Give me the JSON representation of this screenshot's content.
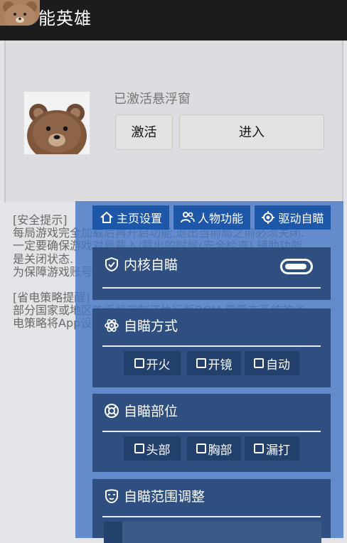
{
  "app": {
    "title": "能英雄"
  },
  "card": {
    "status": "已激活悬浮窗",
    "activate_label": "激活",
    "enter_label": "进入"
  },
  "notice": {
    "lines": [
      "[安全提示]",
      "每局游戏完全加载后再开启功能,退出当前局之前必须关闭.",
      "一定要确保游戏对局载入/载出的时候(安全检查),辅助功能",
      "是关闭状态.",
      "为保障游戏账号安全,推荐使用内核定制版",
      "",
      "[省电策略提醒]",
      "部分国家或地区的手机定制了执行版ROM,需要在系统的省",
      "电策略将App设置无限制."
    ]
  },
  "tabs": [
    {
      "label": "主页设置",
      "icon": "home-icon"
    },
    {
      "label": "人物功能",
      "icon": "people-icon"
    },
    {
      "label": "驱动自瞄",
      "icon": "target-icon"
    }
  ],
  "sections": {
    "kernel": {
      "title": "内核自瞄",
      "icon": "shield-check-icon",
      "toggle_on": false
    },
    "mode": {
      "title": "自瞄方式",
      "icon": "atom-icon",
      "options": [
        "开火",
        "开镜",
        "自动"
      ]
    },
    "part": {
      "title": "自瞄部位",
      "icon": "lifebuoy-icon",
      "options": [
        "头部",
        "胸部",
        "漏打"
      ]
    },
    "range": {
      "title": "自瞄范围调整",
      "icon": "mask-icon"
    }
  },
  "colors": {
    "overlay": "#4878c4",
    "tab": "#1f57a8",
    "section": "#2e4f80",
    "checkbox_bg": "#233f6b"
  }
}
